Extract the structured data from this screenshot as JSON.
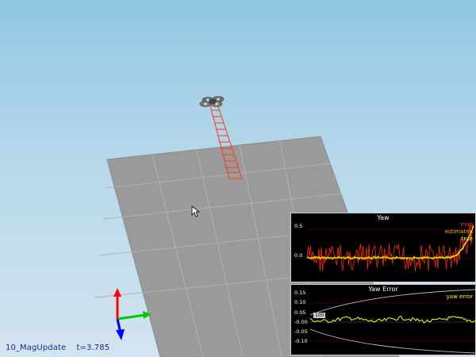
{
  "status": {
    "scenario": "10_MagUpdate",
    "time": "t=3.785"
  },
  "yaw_plot": {
    "title": "Yaw",
    "tick_labels": [
      "0.5",
      "0.0"
    ],
    "legend": [
      "mag",
      "estimated",
      "true"
    ],
    "legend_colors": [
      "#ff2a00",
      "#ffa500",
      "#ffff00"
    ]
  },
  "yaw_error_plot": {
    "title": "Yaw Error",
    "tick_labels": [
      "0.15",
      "0.10",
      "0.05",
      "-0.00",
      "-0.05",
      "-0.10"
    ],
    "legend": [
      "yaw error"
    ],
    "legend_colors": [
      "#ffff00"
    ],
    "marker_label": "100"
  },
  "axis_gizmo_colors": {
    "x": "#00c800",
    "y": "#0000ff",
    "z": "#ff0000"
  },
  "trail_color": "#ff3a14"
}
